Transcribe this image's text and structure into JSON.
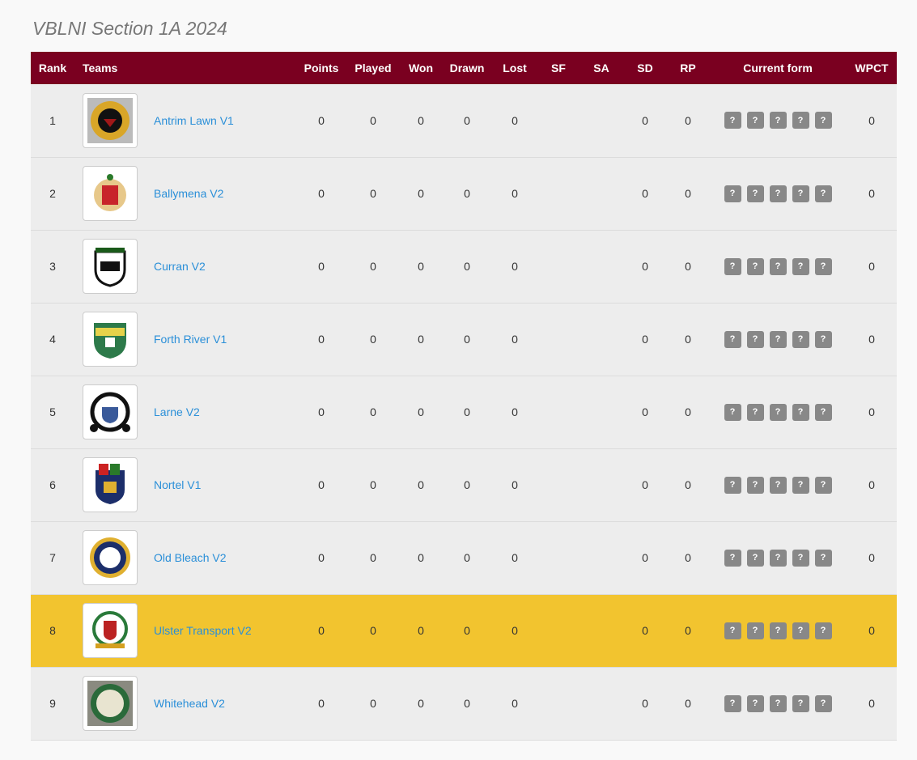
{
  "title": "VBLNI Section 1A 2024",
  "colors": {
    "header": "#7a0020",
    "highlight": "#f2c42f",
    "link": "#2a8fd8",
    "badge": "#888888"
  },
  "columns": [
    "Rank",
    "Teams",
    "Points",
    "Played",
    "Won",
    "Drawn",
    "Lost",
    "SF",
    "SA",
    "SD",
    "RP",
    "Current form",
    "WPCT"
  ],
  "rows": [
    {
      "rank": "1",
      "team": "Antrim Lawn V1",
      "points": "0",
      "played": "0",
      "won": "0",
      "drawn": "0",
      "lost": "0",
      "sf": "",
      "sa": "",
      "sd": "0",
      "rp": "0",
      "form": [
        "?",
        "?",
        "?",
        "?",
        "?"
      ],
      "wpct": "0",
      "logo": "gold-crest",
      "highlight": false
    },
    {
      "rank": "2",
      "team": "Ballymena V2",
      "points": "0",
      "played": "0",
      "won": "0",
      "drawn": "0",
      "lost": "0",
      "sf": "",
      "sa": "",
      "sd": "0",
      "rp": "0",
      "form": [
        "?",
        "?",
        "?",
        "?",
        "?"
      ],
      "wpct": "0",
      "logo": "red-shield",
      "highlight": false
    },
    {
      "rank": "3",
      "team": "Curran V2",
      "points": "0",
      "played": "0",
      "won": "0",
      "drawn": "0",
      "lost": "0",
      "sf": "",
      "sa": "",
      "sd": "0",
      "rp": "0",
      "form": [
        "?",
        "?",
        "?",
        "?",
        "?"
      ],
      "wpct": "0",
      "logo": "castle-shield",
      "highlight": false
    },
    {
      "rank": "4",
      "team": "Forth River V1",
      "points": "0",
      "played": "0",
      "won": "0",
      "drawn": "0",
      "lost": "0",
      "sf": "",
      "sa": "",
      "sd": "0",
      "rp": "0",
      "form": [
        "?",
        "?",
        "?",
        "?",
        "?"
      ],
      "wpct": "0",
      "logo": "green-shield",
      "highlight": false
    },
    {
      "rank": "5",
      "team": "Larne V2",
      "points": "0",
      "played": "0",
      "won": "0",
      "drawn": "0",
      "lost": "0",
      "sf": "",
      "sa": "",
      "sd": "0",
      "rp": "0",
      "form": [
        "?",
        "?",
        "?",
        "?",
        "?"
      ],
      "wpct": "0",
      "logo": "black-circle",
      "highlight": false
    },
    {
      "rank": "6",
      "team": "Nortel V1",
      "points": "0",
      "played": "0",
      "won": "0",
      "drawn": "0",
      "lost": "0",
      "sf": "",
      "sa": "",
      "sd": "0",
      "rp": "0",
      "form": [
        "?",
        "?",
        "?",
        "?",
        "?"
      ],
      "wpct": "0",
      "logo": "navy-shield",
      "highlight": false
    },
    {
      "rank": "7",
      "team": "Old Bleach V2",
      "points": "0",
      "played": "0",
      "won": "0",
      "drawn": "0",
      "lost": "0",
      "sf": "",
      "sa": "",
      "sd": "0",
      "rp": "0",
      "form": [
        "?",
        "?",
        "?",
        "?",
        "?"
      ],
      "wpct": "0",
      "logo": "navy-circle",
      "highlight": false
    },
    {
      "rank": "8",
      "team": "Ulster Transport V2",
      "points": "0",
      "played": "0",
      "won": "0",
      "drawn": "0",
      "lost": "0",
      "sf": "",
      "sa": "",
      "sd": "0",
      "rp": "0",
      "form": [
        "?",
        "?",
        "?",
        "?",
        "?"
      ],
      "wpct": "0",
      "logo": "green-circle",
      "highlight": true
    },
    {
      "rank": "9",
      "team": "Whitehead V2",
      "points": "0",
      "played": "0",
      "won": "0",
      "drawn": "0",
      "lost": "0",
      "sf": "",
      "sa": "",
      "sd": "0",
      "rp": "0",
      "form": [
        "?",
        "?",
        "?",
        "?",
        "?"
      ],
      "wpct": "0",
      "logo": "green-badge",
      "highlight": false
    }
  ]
}
